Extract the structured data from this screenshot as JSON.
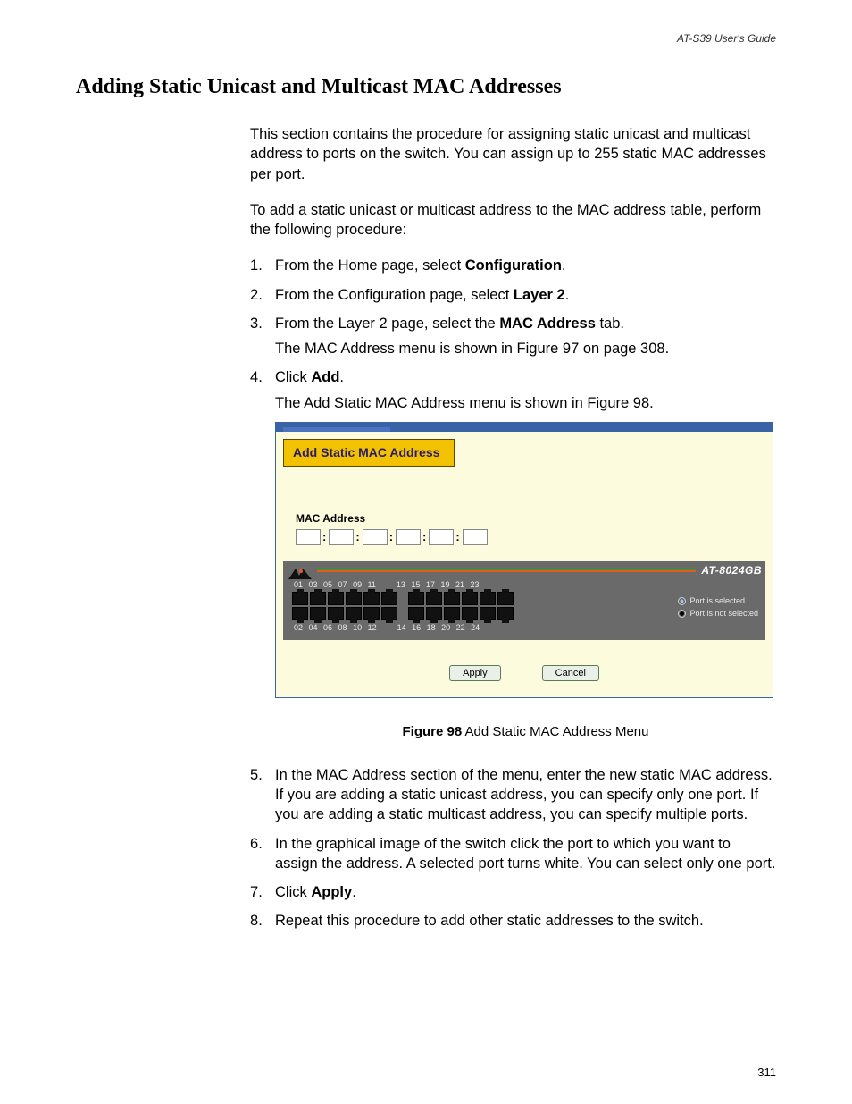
{
  "header": {
    "guide": "AT-S39 User's Guide"
  },
  "title": "Adding Static Unicast and Multicast MAC Addresses",
  "intro1": "This section contains the procedure for assigning static unicast and multicast address to ports on the switch. You can assign up to 255 static MAC addresses per port.",
  "intro2": "To add a static unicast or multicast address to the MAC address table, perform the following procedure:",
  "steps": {
    "s1a": "From the Home page, select ",
    "s1b": "Configuration",
    "s1c": ".",
    "s2a": "From the Configuration page, select ",
    "s2b": "Layer 2",
    "s2c": ".",
    "s3a": "From the Layer 2 page, select the ",
    "s3b": "MAC Address",
    "s3c": " tab.",
    "s3p": "The MAC Address menu is shown in Figure 97 on page 308.",
    "s4a": "Click ",
    "s4b": "Add",
    "s4c": ".",
    "s4p": "The Add Static MAC Address menu is shown in Figure 98.",
    "s5": "In the MAC Address section of the menu, enter the new static MAC address. If you are adding a static unicast address, you can specify only one port. If you are adding a static multicast address, you can specify multiple ports.",
    "s6": "In the graphical image of the switch click the port to which you want to assign the address. A selected port turns white. You can select only one port.",
    "s7a": "Click ",
    "s7b": "Apply",
    "s7c": ".",
    "s8": "Repeat this procedure to add other static addresses to the switch."
  },
  "dialog": {
    "heading": "Add Static MAC Address",
    "macLabel": "MAC Address",
    "model": "AT-8024GB",
    "legendSelected": "Port is selected",
    "legendNotSelected": "Port is not selected",
    "applyBtn": "Apply",
    "cancelBtn": "Cancel",
    "topPorts": [
      "01",
      "03",
      "05",
      "07",
      "09",
      "11",
      "13",
      "15",
      "17",
      "19",
      "21",
      "23"
    ],
    "botPorts": [
      "02",
      "04",
      "06",
      "08",
      "10",
      "12",
      "14",
      "16",
      "18",
      "20",
      "22",
      "24"
    ]
  },
  "figure": {
    "label": "Figure 98",
    "caption": "  Add Static MAC Address Menu"
  },
  "pageNumber": "311"
}
